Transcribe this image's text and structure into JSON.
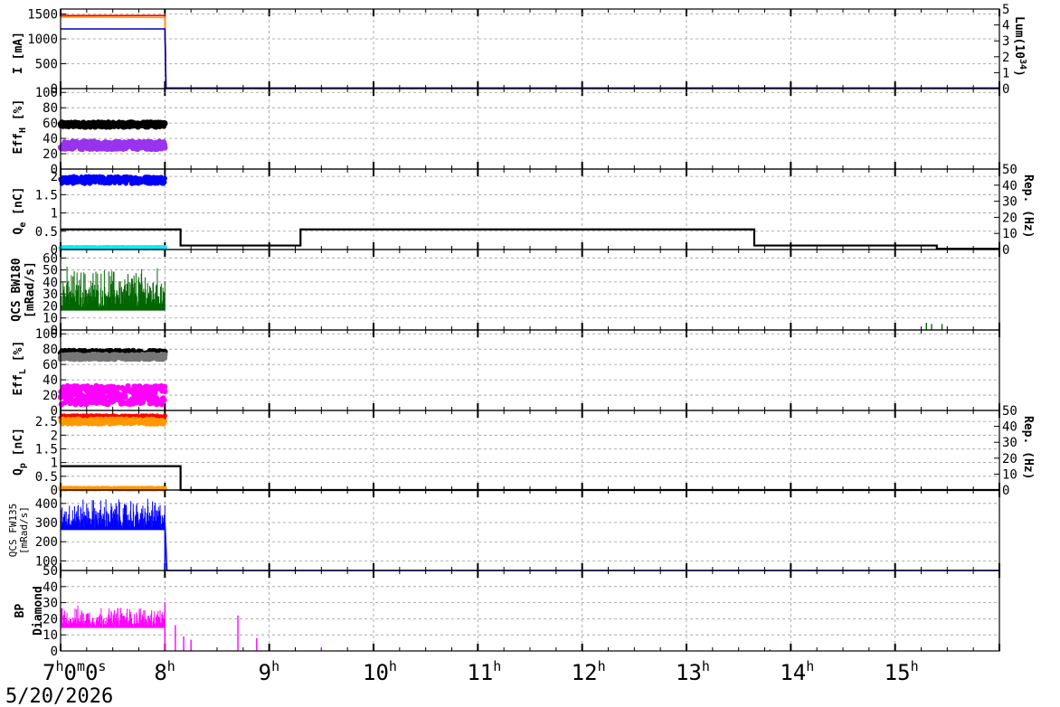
{
  "date_label": "5/20/2026",
  "x_ticks": [
    {
      "main": "7",
      "sup": "h",
      "extra": [
        [
          "0",
          "m"
        ],
        [
          "0",
          "s"
        ]
      ]
    },
    {
      "main": "8",
      "sup": "h"
    },
    {
      "main": "9",
      "sup": "h"
    },
    {
      "main": "10",
      "sup": "h"
    },
    {
      "main": "11",
      "sup": "h"
    },
    {
      "main": "12",
      "sup": "h"
    },
    {
      "main": "13",
      "sup": "h"
    },
    {
      "main": "14",
      "sup": "h"
    },
    {
      "main": "15",
      "sup": "h"
    }
  ],
  "colors": {
    "red": "#ff0000",
    "orange": "#ff9900",
    "navy": "#0000aa",
    "black": "#000000",
    "purple": "#9933ee",
    "blue": "#0000ff",
    "cyan": "#00eeff",
    "green": "#006600",
    "gray": "#777777",
    "magenta": "#ff00ff",
    "grid": "#999999"
  },
  "chart_data": [
    {
      "type": "line",
      "panel": "current",
      "ylabel": "I [mA]",
      "ylabel2": "Lum(10^34)",
      "ylim": [
        0,
        1600
      ],
      "ylim2": [
        0,
        5
      ],
      "yticks": [
        "0",
        "500",
        "1000",
        "1500"
      ],
      "yticks2": [
        "0",
        "1",
        "2",
        "3",
        "4",
        "5"
      ],
      "x_unit": "hours since 7h on 5/20/2026",
      "xlim": [
        7,
        16
      ],
      "grid": true,
      "series": [
        {
          "color": "red",
          "x": [
            7,
            8,
            8.01,
            16
          ],
          "y": [
            1470,
            1470,
            10,
            10
          ]
        },
        {
          "color": "orange",
          "x": [
            7,
            8,
            8.01
          ],
          "y": [
            1440,
            1430,
            10
          ]
        },
        {
          "color": "navy",
          "x": [
            7,
            8,
            8.01,
            16
          ],
          "y": [
            1200,
            1200,
            10,
            10
          ]
        }
      ]
    },
    {
      "type": "scatter",
      "panel": "effh",
      "ylabel": "EffH [%]",
      "ylim": [
        0,
        105
      ],
      "yticks": [
        "0",
        "20",
        "40",
        "60",
        "80",
        "100"
      ],
      "xlim": [
        7,
        16
      ],
      "grid": true,
      "series": [
        {
          "color": "black",
          "x_range": [
            7,
            8
          ],
          "mean": 58,
          "spread": 3
        },
        {
          "color": "purple",
          "x_range": [
            7,
            8
          ],
          "mean": 31,
          "spread": 5
        }
      ]
    },
    {
      "type": "line",
      "panel": "qe",
      "ylabel": "Qe [nC]",
      "ylabel2": "Rep. (Hz)",
      "ylim": [
        0,
        2.2
      ],
      "ylim2": [
        0,
        50
      ],
      "yticks": [
        "0",
        "0.5",
        "1",
        "1.5",
        "2"
      ],
      "yticks2": [
        "0",
        "10",
        "20",
        "30",
        "40",
        "50"
      ],
      "xlim": [
        7,
        16
      ],
      "grid": true,
      "series": [
        {
          "color": "blue",
          "x_range": [
            7,
            8
          ],
          "mean": 1.9,
          "spread": 0.1
        },
        {
          "color": "cyan",
          "x_range": [
            7,
            8
          ],
          "mean": 0.05,
          "spread": 0.01
        },
        {
          "color": "black",
          "axis": "right",
          "x": [
            7,
            8.15,
            8.15,
            9.3,
            9.3,
            13.65,
            13.65,
            15.4,
            15.4,
            16
          ],
          "y": [
            12.5,
            12.5,
            2.5,
            2.5,
            12.5,
            12.5,
            2.5,
            2.5,
            0.5,
            0.5
          ]
        }
      ]
    },
    {
      "type": "bar",
      "panel": "qcs_bw180",
      "ylabel": "QCS BW180",
      "ylabel_line2": "[mRad/s]",
      "ylim": [
        0,
        67
      ],
      "yticks": [
        "0",
        "10",
        "20",
        "30",
        "40",
        "50",
        "60"
      ],
      "xlim": [
        7,
        16
      ],
      "grid": true,
      "series": [
        {
          "color": "green",
          "x_range": [
            7,
            8
          ],
          "base": 18,
          "peak": 55
        },
        {
          "color": "green",
          "x": [
            15.3,
            15.35,
            15.45
          ],
          "y": [
            6,
            5,
            5
          ]
        }
      ]
    },
    {
      "type": "scatter",
      "panel": "effl",
      "ylabel": "EffL [%]",
      "ylim": [
        0,
        105
      ],
      "yticks": [
        "0",
        "20",
        "40",
        "60",
        "80",
        "100"
      ],
      "xlim": [
        7,
        16
      ],
      "grid": true,
      "series": [
        {
          "color": "black",
          "x_range": [
            7,
            8
          ],
          "mean": 74,
          "spread": 4
        },
        {
          "color": "gray",
          "x_range": [
            7,
            8
          ],
          "mean": 70,
          "spread": 3
        },
        {
          "color": "magenta",
          "x_range": [
            7,
            8
          ],
          "mean": 20,
          "spread": 12
        }
      ]
    },
    {
      "type": "line",
      "panel": "qp",
      "ylabel": "Qp [nC]",
      "ylabel2": "Rep. (Hz)",
      "ylim": [
        0,
        2.9
      ],
      "ylim2": [
        0,
        50
      ],
      "yticks": [
        "0",
        "0.5",
        "1",
        "1.5",
        "2",
        "2.5"
      ],
      "yticks2": [
        "0",
        "10",
        "20",
        "30",
        "40",
        "50"
      ],
      "xlim": [
        7,
        16
      ],
      "grid": true,
      "series": [
        {
          "color": "red",
          "x_range": [
            7,
            8
          ],
          "mean": 2.65,
          "spread": 0.06
        },
        {
          "color": "orange",
          "x_range": [
            7,
            8
          ],
          "mean": 2.5,
          "spread": 0.1
        },
        {
          "color": "orange",
          "x_range": [
            7,
            8
          ],
          "mean": 0.05,
          "spread": 0.02
        },
        {
          "color": "black",
          "axis": "right",
          "x": [
            7,
            8.15,
            8.15,
            16
          ],
          "y": [
            15,
            15,
            0,
            0
          ]
        }
      ]
    },
    {
      "type": "bar",
      "panel": "qcs_fw135",
      "ylabel": "QCS FW135",
      "ylabel_line2": "[mRad/s]",
      "ylim": [
        50,
        470
      ],
      "yticks": [
        "50",
        "100",
        "200",
        "300",
        "400"
      ],
      "xlim": [
        7,
        16
      ],
      "grid": true,
      "series": [
        {
          "color": "blue",
          "x_range": [
            7,
            8
          ],
          "base": 270,
          "peak": 440
        },
        {
          "color": "blue",
          "x": [
            8,
            8.02,
            16
          ],
          "y": [
            300,
            50,
            50
          ]
        }
      ]
    },
    {
      "type": "bar",
      "panel": "bp_diamond",
      "ylabel": "BP",
      "ylabel_line2": "Diamond",
      "ylim": [
        0,
        50
      ],
      "yticks": [
        "0",
        "10",
        "20",
        "30",
        "40"
      ],
      "xlim": [
        7,
        16
      ],
      "grid": true,
      "series": [
        {
          "color": "magenta",
          "x_range": [
            7,
            8
          ],
          "base": 15,
          "peak": 29
        },
        {
          "color": "magenta",
          "x": [
            8.0,
            8.1,
            8.18,
            8.25,
            8.7,
            8.88,
            9.5,
            11.5,
            13.8
          ],
          "y": [
            30,
            16,
            9,
            7,
            22,
            8,
            2,
            1,
            1
          ]
        }
      ]
    }
  ]
}
